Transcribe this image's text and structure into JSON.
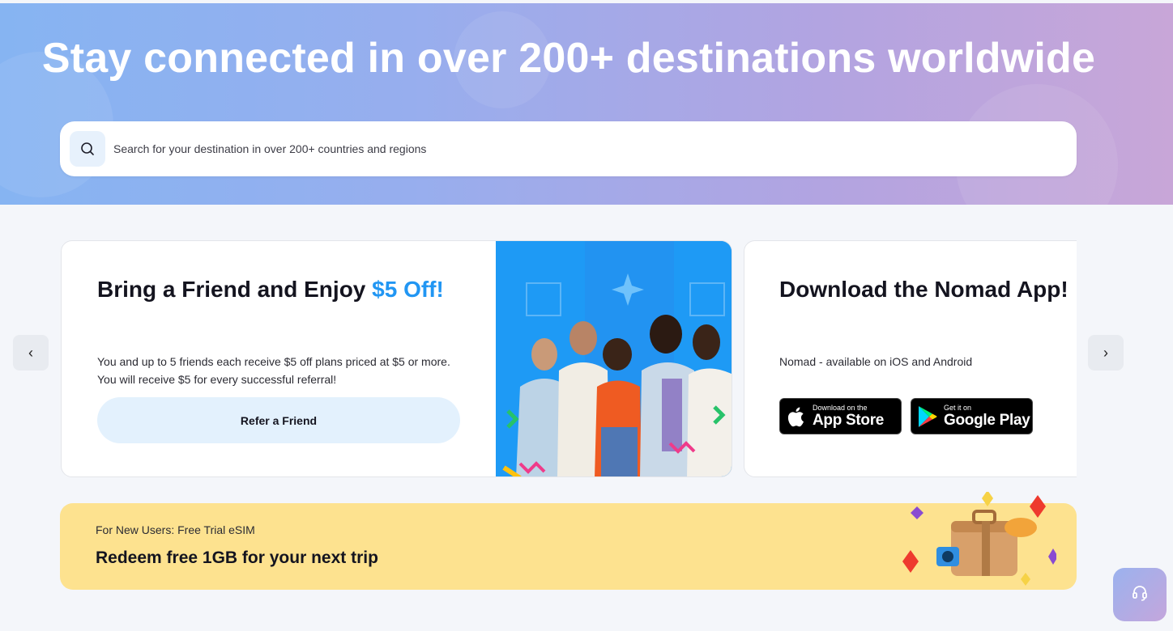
{
  "hero": {
    "title": "Stay connected in over 200+ destinations worldwide",
    "search_placeholder": "Search for your destination in over 200+ countries and regions",
    "icon": "search-icon"
  },
  "carousel": {
    "prev_label": "‹",
    "next_label": "›",
    "referral": {
      "title_main": "Bring a Friend and Enjoy ",
      "title_accent": "$5 Off!",
      "description": "You and up to 5 friends each receive $5 off plans priced at $5 or more. You will receive $5 for every successful referral!",
      "button_label": "Refer a Friend"
    },
    "app": {
      "title": "Download the Nomad App!",
      "description": "Nomad - available on iOS and Android",
      "app_store_small": "Download on the",
      "app_store_big": "App Store",
      "google_play_small": "Get it on",
      "google_play_big": "Google Play"
    }
  },
  "trial": {
    "label": "For New Users: Free Trial eSIM",
    "title": "Redeem free 1GB for your next trip"
  },
  "support": {
    "icon": "headset-icon"
  },
  "colors": {
    "accent": "#2196f3",
    "banner_yellow": "#fde28f",
    "hero_start": "#86b4f2",
    "hero_end": "#c8a6d8"
  }
}
